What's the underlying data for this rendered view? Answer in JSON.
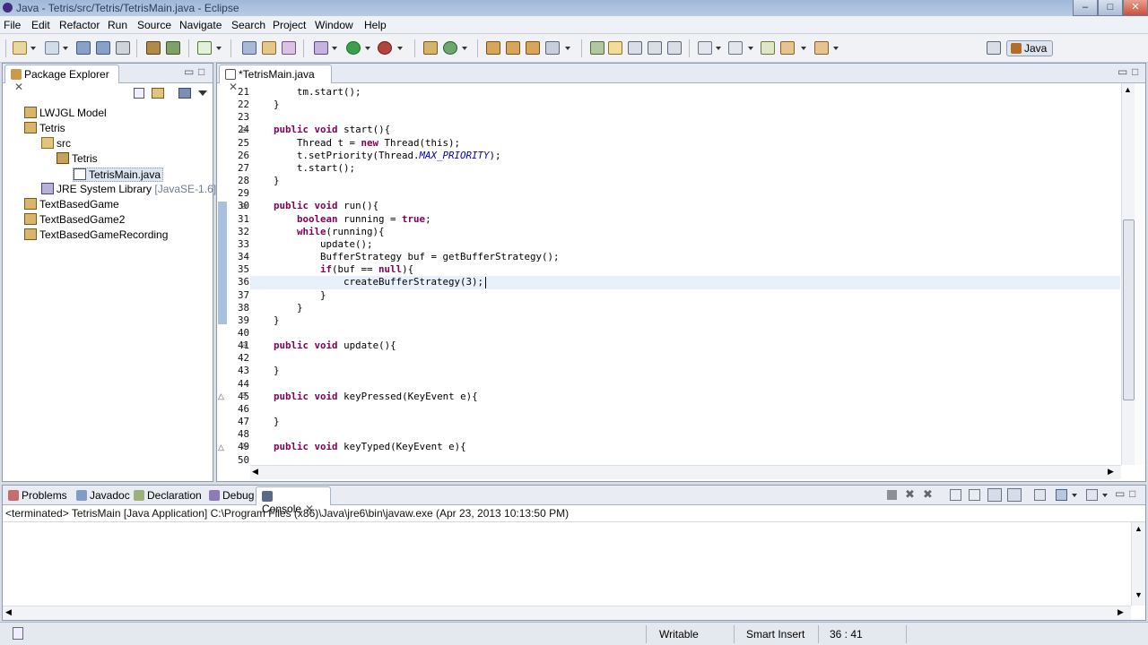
{
  "window": {
    "title": "Java - Tetris/src/Tetris/TetrisMain.java - Eclipse",
    "min": "–",
    "max": "□",
    "close": "✕"
  },
  "menu": [
    "File",
    "Edit",
    "Refactor",
    "Run",
    "Source",
    "Navigate",
    "Search",
    "Project",
    "Window",
    "Help"
  ],
  "perspective": {
    "label": "Java"
  },
  "package_explorer": {
    "tab_label": "Package Explorer",
    "tree": [
      {
        "label": "LWJGL Model",
        "suffix": ""
      },
      {
        "label": "Tetris",
        "suffix": ""
      },
      {
        "label": "src",
        "suffix": ""
      },
      {
        "label": "Tetris",
        "suffix": ""
      },
      {
        "label": "TetrisMain.java",
        "suffix": ""
      },
      {
        "label": "JRE System Library",
        "suffix": "[JavaSE-1.6]"
      },
      {
        "label": "TextBasedGame",
        "suffix": ""
      },
      {
        "label": "TextBasedGame2",
        "suffix": ""
      },
      {
        "label": "TextBasedGameRecording",
        "suffix": ""
      }
    ]
  },
  "editor": {
    "tab_label": "*TetrisMain.java",
    "line_numbers": [
      "21",
      "22",
      "23",
      "24",
      "25",
      "26",
      "27",
      "28",
      "29",
      "30",
      "31",
      "32",
      "33",
      "34",
      "35",
      "36",
      "37",
      "38",
      "39",
      "40",
      "41",
      "42",
      "43",
      "44",
      "45",
      "46",
      "47",
      "48",
      "49",
      "50"
    ],
    "lines": [
      "        tm.start();",
      "    }",
      "",
      "    public void start(){",
      "        Thread t = new Thread(this);",
      "        t.setPriority(Thread.MAX_PRIORITY);",
      "        t.start();",
      "    }",
      "",
      "    public void run(){",
      "        boolean running = true;",
      "        while(running){",
      "            update();",
      "            BufferStrategy buf = getBufferStrategy();",
      "            if(buf == null){",
      "                createBufferStrategy(3);",
      "            }",
      "        }",
      "    }",
      "",
      "    public void update(){",
      "",
      "    }",
      "",
      "    public void keyPressed(KeyEvent e){",
      "",
      "    }",
      "",
      "    public void keyTyped(KeyEvent e){",
      ""
    ]
  },
  "bottom_tabs": [
    "Problems",
    "Javadoc",
    "Declaration",
    "Debug",
    "Console"
  ],
  "console": {
    "header": "<terminated> TetrisMain [Java Application] C:\\Program Files (x86)\\Java\\jre6\\bin\\javaw.exe (Apr 23, 2013 10:13:50 PM)"
  },
  "status": {
    "writable": "Writable",
    "insert_mode": "Smart Insert",
    "position": "36 : 41"
  }
}
